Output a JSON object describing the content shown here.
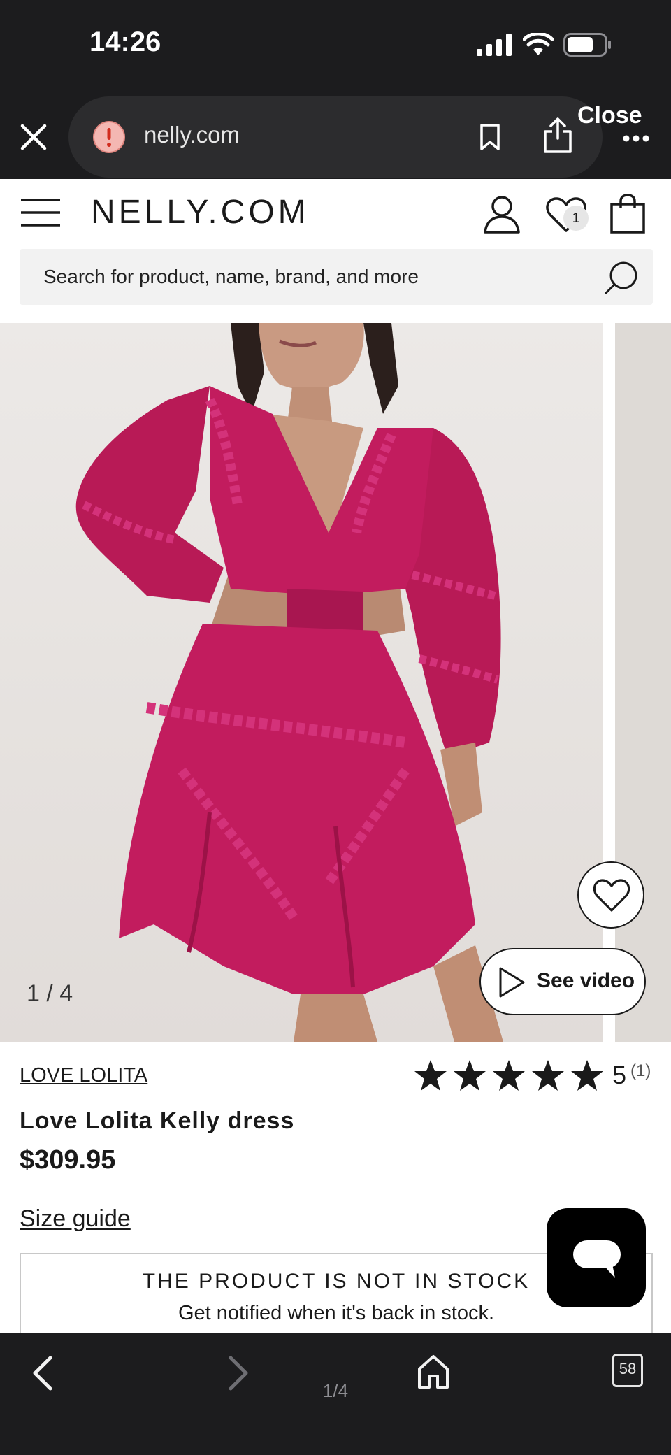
{
  "status_bar": {
    "time": "14:26"
  },
  "browser": {
    "url": "nelly.com",
    "close_label": "Close",
    "page_indicator": "1/4",
    "tabs_count": "58"
  },
  "header": {
    "logo": "NELLY.COM",
    "wishlist_count": "1",
    "search_placeholder": "Search for product, name, brand, and more"
  },
  "gallery": {
    "counter": "1 / 4",
    "video_label": "See video",
    "dress_color": "#c21c5e"
  },
  "product": {
    "brand": "LOVE LOLITA",
    "name": "Love Lolita Kelly dress",
    "price": "$309.95",
    "rating": {
      "stars": 5,
      "value": "5",
      "count": "(1)"
    },
    "size_guide": "Size guide",
    "stock_title": "THE PRODUCT IS NOT IN STOCK",
    "stock_subtitle": "Get notified when it's back in stock."
  },
  "colors": {
    "browser_chrome": "#1c1c1e",
    "accent_dress": "#c21c5e"
  }
}
